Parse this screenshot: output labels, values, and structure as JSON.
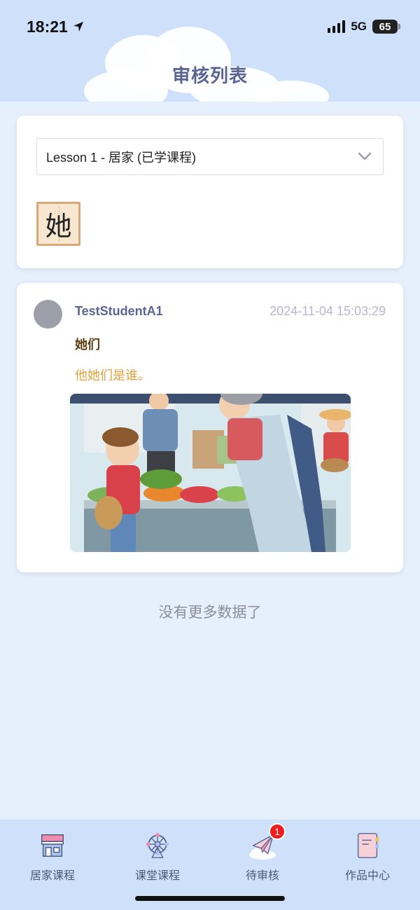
{
  "status_bar": {
    "time": "18:21",
    "network": "5G",
    "battery": "65"
  },
  "header": {
    "title": "审核列表"
  },
  "selector": {
    "selected": "Lesson 1 - 居家 (已学课程)",
    "icon": "chevron-down-icon"
  },
  "character": {
    "glyph": "她"
  },
  "post": {
    "username": "TestStudentA1",
    "timestamp": "2024-11-04 15:03:29",
    "answer": "她们",
    "sentence": "他她们是谁。"
  },
  "list_end": "没有更多数据了",
  "tabbar": {
    "items": [
      {
        "label": "居家课程",
        "icon": "home-store-icon"
      },
      {
        "label": "课堂课程",
        "icon": "ferris-wheel-icon"
      },
      {
        "label": "待审核",
        "icon": "paper-plane-icon"
      },
      {
        "label": "作品中心",
        "icon": "notebook-icon"
      }
    ],
    "badge": "1"
  },
  "colors": {
    "header_bg": "#cfe0fa",
    "page_bg": "#e6effc",
    "title": "#5a6595",
    "username": "#5a6595",
    "timestamp": "#b7b5d9",
    "answer": "#5e3e12",
    "sentence": "#e0a23c",
    "badge": "#f21b1b"
  }
}
